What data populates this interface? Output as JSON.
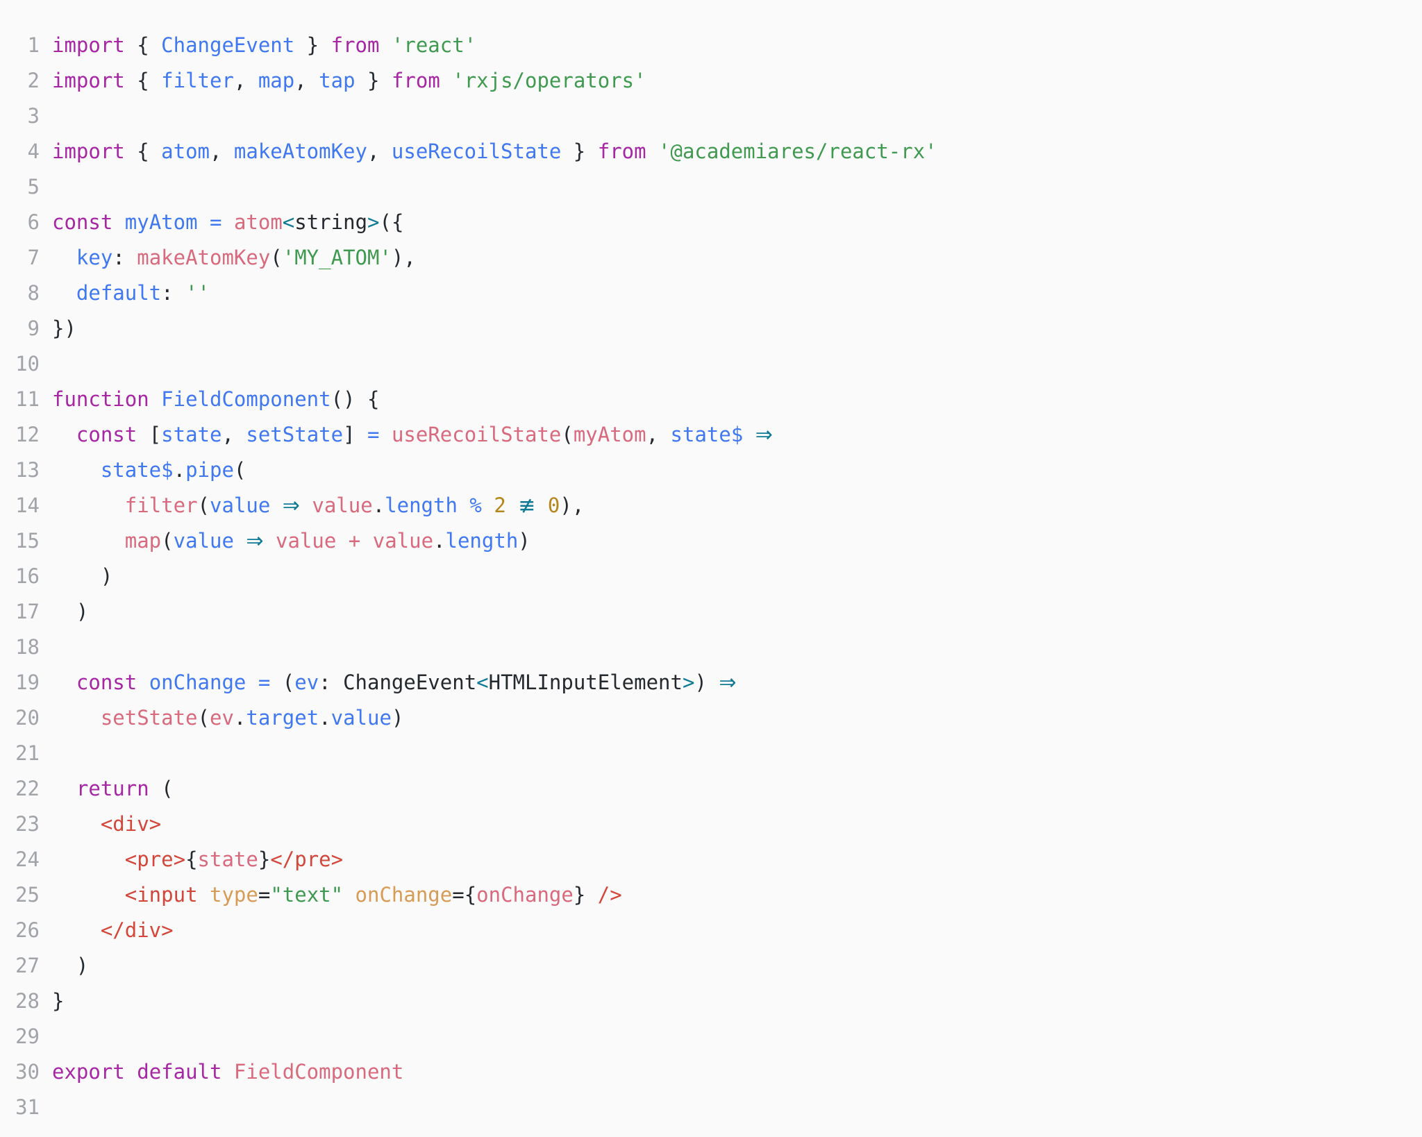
{
  "editor": {
    "language": "tsx",
    "background": "#fafafa",
    "gutter_color": "#a0a4a8",
    "theme_colors": {
      "keyword": "#a626a4",
      "variable": "#4078f2",
      "function": "#d9697d",
      "string": "#3f9a50",
      "number": "#b5861a",
      "punctuation": "#24292e",
      "operator": "#0f7a94",
      "jsx_tag": "#d4453a",
      "jsx_attribute": "#d79b56",
      "type": "#24292e"
    },
    "total_lines": 31,
    "plain_text": "import { ChangeEvent } from 'react'\nimport { filter, map, tap } from 'rxjs/operators'\n\nimport { atom, makeAtomKey, useRecoilState } from '@academiares/react-rx'\n\nconst myAtom = atom<string>({\n  key: makeAtomKey('MY_ATOM'),\n  default: ''\n})\n\nfunction FieldComponent() {\n  const [state, setState] = useRecoilState(myAtom, state$ =>\n    state$.pipe(\n      filter(value => value.length % 2 !== 0),\n      map(value => value + value.length)\n    )\n  )\n\n  const onChange = (ev: ChangeEvent<HTMLInputElement>) =>\n    setState(ev.target.value)\n\n  return (\n    <div>\n      <pre>{state}</pre>\n      <input type=\"text\" onChange={onChange} />\n    </div>\n  )\n}\n\nexport default FieldComponent\n",
    "lines": [
      {
        "n": "1",
        "tokens": [
          {
            "t": "import",
            "c": "kw"
          },
          {
            "t": " { ",
            "c": "punc"
          },
          {
            "t": "ChangeEvent",
            "c": "var"
          },
          {
            "t": " } ",
            "c": "punc"
          },
          {
            "t": "from",
            "c": "kw"
          },
          {
            "t": " ",
            "c": "punc"
          },
          {
            "t": "'react'",
            "c": "str"
          }
        ]
      },
      {
        "n": "2",
        "tokens": [
          {
            "t": "import",
            "c": "kw"
          },
          {
            "t": " { ",
            "c": "punc"
          },
          {
            "t": "filter",
            "c": "var"
          },
          {
            "t": ", ",
            "c": "punc"
          },
          {
            "t": "map",
            "c": "var"
          },
          {
            "t": ", ",
            "c": "punc"
          },
          {
            "t": "tap",
            "c": "var"
          },
          {
            "t": " } ",
            "c": "punc"
          },
          {
            "t": "from",
            "c": "kw"
          },
          {
            "t": " ",
            "c": "punc"
          },
          {
            "t": "'rxjs/operators'",
            "c": "str"
          }
        ]
      },
      {
        "n": "3",
        "tokens": []
      },
      {
        "n": "4",
        "tokens": [
          {
            "t": "import",
            "c": "kw"
          },
          {
            "t": " { ",
            "c": "punc"
          },
          {
            "t": "atom",
            "c": "var"
          },
          {
            "t": ", ",
            "c": "punc"
          },
          {
            "t": "makeAtomKey",
            "c": "var"
          },
          {
            "t": ", ",
            "c": "punc"
          },
          {
            "t": "useRecoilState",
            "c": "var"
          },
          {
            "t": " } ",
            "c": "punc"
          },
          {
            "t": "from",
            "c": "kw"
          },
          {
            "t": " ",
            "c": "punc"
          },
          {
            "t": "'@academiares/react-rx'",
            "c": "str"
          }
        ]
      },
      {
        "n": "5",
        "tokens": []
      },
      {
        "n": "6",
        "tokens": [
          {
            "t": "const",
            "c": "kw"
          },
          {
            "t": " ",
            "c": "punc"
          },
          {
            "t": "myAtom",
            "c": "var"
          },
          {
            "t": " ",
            "c": "punc"
          },
          {
            "t": "=",
            "c": "var"
          },
          {
            "t": " ",
            "c": "punc"
          },
          {
            "t": "atom",
            "c": "fn"
          },
          {
            "t": "<",
            "c": "op"
          },
          {
            "t": "string",
            "c": "type"
          },
          {
            "t": ">",
            "c": "op"
          },
          {
            "t": "({",
            "c": "punc"
          }
        ]
      },
      {
        "n": "7",
        "tokens": [
          {
            "t": "  ",
            "c": "punc"
          },
          {
            "t": "key",
            "c": "var"
          },
          {
            "t": ": ",
            "c": "punc"
          },
          {
            "t": "makeAtomKey",
            "c": "fn"
          },
          {
            "t": "(",
            "c": "punc"
          },
          {
            "t": "'MY_ATOM'",
            "c": "str"
          },
          {
            "t": "),",
            "c": "punc"
          }
        ]
      },
      {
        "n": "8",
        "tokens": [
          {
            "t": "  ",
            "c": "punc"
          },
          {
            "t": "default",
            "c": "var"
          },
          {
            "t": ": ",
            "c": "punc"
          },
          {
            "t": "''",
            "c": "str"
          }
        ]
      },
      {
        "n": "9",
        "tokens": [
          {
            "t": "})",
            "c": "punc"
          }
        ]
      },
      {
        "n": "10",
        "tokens": []
      },
      {
        "n": "11",
        "tokens": [
          {
            "t": "function",
            "c": "kw"
          },
          {
            "t": " ",
            "c": "punc"
          },
          {
            "t": "FieldComponent",
            "c": "var"
          },
          {
            "t": "() {",
            "c": "punc"
          }
        ]
      },
      {
        "n": "12",
        "tokens": [
          {
            "t": "  ",
            "c": "punc"
          },
          {
            "t": "const",
            "c": "kw"
          },
          {
            "t": " [",
            "c": "punc"
          },
          {
            "t": "state",
            "c": "var"
          },
          {
            "t": ", ",
            "c": "punc"
          },
          {
            "t": "setState",
            "c": "var"
          },
          {
            "t": "] ",
            "c": "punc"
          },
          {
            "t": "=",
            "c": "var"
          },
          {
            "t": " ",
            "c": "punc"
          },
          {
            "t": "useRecoilState",
            "c": "fn"
          },
          {
            "t": "(",
            "c": "punc"
          },
          {
            "t": "myAtom",
            "c": "fn"
          },
          {
            "t": ", ",
            "c": "punc"
          },
          {
            "t": "state$",
            "c": "var"
          },
          {
            "t": " ",
            "c": "punc"
          },
          {
            "t": "⇒",
            "c": "lig"
          }
        ]
      },
      {
        "n": "13",
        "tokens": [
          {
            "t": "    ",
            "c": "punc"
          },
          {
            "t": "state$",
            "c": "var"
          },
          {
            "t": ".",
            "c": "punc"
          },
          {
            "t": "pipe",
            "c": "var"
          },
          {
            "t": "(",
            "c": "punc"
          }
        ]
      },
      {
        "n": "14",
        "tokens": [
          {
            "t": "      ",
            "c": "punc"
          },
          {
            "t": "filter",
            "c": "fn"
          },
          {
            "t": "(",
            "c": "punc"
          },
          {
            "t": "value",
            "c": "var"
          },
          {
            "t": " ",
            "c": "punc"
          },
          {
            "t": "⇒",
            "c": "lig"
          },
          {
            "t": " ",
            "c": "punc"
          },
          {
            "t": "value",
            "c": "fn"
          },
          {
            "t": ".",
            "c": "punc"
          },
          {
            "t": "length",
            "c": "var"
          },
          {
            "t": " ",
            "c": "punc"
          },
          {
            "t": "%",
            "c": "var"
          },
          {
            "t": " ",
            "c": "punc"
          },
          {
            "t": "2",
            "c": "num"
          },
          {
            "t": " ",
            "c": "punc"
          },
          {
            "t": "≢",
            "c": "lig"
          },
          {
            "t": " ",
            "c": "punc"
          },
          {
            "t": "0",
            "c": "num"
          },
          {
            "t": "),",
            "c": "punc"
          }
        ]
      },
      {
        "n": "15",
        "tokens": [
          {
            "t": "      ",
            "c": "punc"
          },
          {
            "t": "map",
            "c": "fn"
          },
          {
            "t": "(",
            "c": "punc"
          },
          {
            "t": "value",
            "c": "var"
          },
          {
            "t": " ",
            "c": "punc"
          },
          {
            "t": "⇒",
            "c": "lig"
          },
          {
            "t": " ",
            "c": "punc"
          },
          {
            "t": "value",
            "c": "fn"
          },
          {
            "t": " ",
            "c": "punc"
          },
          {
            "t": "+",
            "c": "fn"
          },
          {
            "t": " ",
            "c": "punc"
          },
          {
            "t": "value",
            "c": "fn"
          },
          {
            "t": ".",
            "c": "punc"
          },
          {
            "t": "length",
            "c": "var"
          },
          {
            "t": ")",
            "c": "punc"
          }
        ]
      },
      {
        "n": "16",
        "tokens": [
          {
            "t": "    )",
            "c": "punc"
          }
        ]
      },
      {
        "n": "17",
        "tokens": [
          {
            "t": "  )",
            "c": "punc"
          }
        ]
      },
      {
        "n": "18",
        "tokens": []
      },
      {
        "n": "19",
        "tokens": [
          {
            "t": "  ",
            "c": "punc"
          },
          {
            "t": "const",
            "c": "kw"
          },
          {
            "t": " ",
            "c": "punc"
          },
          {
            "t": "onChange",
            "c": "var"
          },
          {
            "t": " ",
            "c": "punc"
          },
          {
            "t": "=",
            "c": "var"
          },
          {
            "t": " (",
            "c": "punc"
          },
          {
            "t": "ev",
            "c": "var"
          },
          {
            "t": ": ",
            "c": "punc"
          },
          {
            "t": "ChangeEvent",
            "c": "type"
          },
          {
            "t": "<",
            "c": "op"
          },
          {
            "t": "HTMLInputElement",
            "c": "type"
          },
          {
            "t": ">",
            "c": "op"
          },
          {
            "t": ") ",
            "c": "punc"
          },
          {
            "t": "⇒",
            "c": "lig"
          }
        ]
      },
      {
        "n": "20",
        "tokens": [
          {
            "t": "    ",
            "c": "punc"
          },
          {
            "t": "setState",
            "c": "fn"
          },
          {
            "t": "(",
            "c": "punc"
          },
          {
            "t": "ev",
            "c": "fn"
          },
          {
            "t": ".",
            "c": "punc"
          },
          {
            "t": "target",
            "c": "var"
          },
          {
            "t": ".",
            "c": "punc"
          },
          {
            "t": "value",
            "c": "var"
          },
          {
            "t": ")",
            "c": "punc"
          }
        ]
      },
      {
        "n": "21",
        "tokens": []
      },
      {
        "n": "22",
        "tokens": [
          {
            "t": "  ",
            "c": "punc"
          },
          {
            "t": "return",
            "c": "kw"
          },
          {
            "t": " (",
            "c": "punc"
          }
        ]
      },
      {
        "n": "23",
        "tokens": [
          {
            "t": "    ",
            "c": "punc"
          },
          {
            "t": "<div>",
            "c": "tag"
          }
        ]
      },
      {
        "n": "24",
        "tokens": [
          {
            "t": "      ",
            "c": "punc"
          },
          {
            "t": "<pre>",
            "c": "tag"
          },
          {
            "t": "{",
            "c": "punc"
          },
          {
            "t": "state",
            "c": "fn"
          },
          {
            "t": "}",
            "c": "punc"
          },
          {
            "t": "</pre>",
            "c": "tag"
          }
        ]
      },
      {
        "n": "25",
        "tokens": [
          {
            "t": "      ",
            "c": "punc"
          },
          {
            "t": "<input",
            "c": "tag"
          },
          {
            "t": " ",
            "c": "punc"
          },
          {
            "t": "type",
            "c": "attr"
          },
          {
            "t": "=",
            "c": "punc"
          },
          {
            "t": "\"text\"",
            "c": "str"
          },
          {
            "t": " ",
            "c": "punc"
          },
          {
            "t": "onChange",
            "c": "attr"
          },
          {
            "t": "={",
            "c": "punc"
          },
          {
            "t": "onChange",
            "c": "fn"
          },
          {
            "t": "}",
            "c": "punc"
          },
          {
            "t": " ",
            "c": "punc"
          },
          {
            "t": "/>",
            "c": "tag"
          }
        ]
      },
      {
        "n": "26",
        "tokens": [
          {
            "t": "    ",
            "c": "punc"
          },
          {
            "t": "</div>",
            "c": "tag"
          }
        ]
      },
      {
        "n": "27",
        "tokens": [
          {
            "t": "  )",
            "c": "punc"
          }
        ]
      },
      {
        "n": "28",
        "tokens": [
          {
            "t": "}",
            "c": "punc"
          }
        ]
      },
      {
        "n": "29",
        "tokens": []
      },
      {
        "n": "30",
        "tokens": [
          {
            "t": "export",
            "c": "kw"
          },
          {
            "t": " ",
            "c": "punc"
          },
          {
            "t": "default",
            "c": "kw"
          },
          {
            "t": " ",
            "c": "punc"
          },
          {
            "t": "FieldComponent",
            "c": "fn"
          }
        ]
      },
      {
        "n": "31",
        "tokens": []
      }
    ]
  }
}
